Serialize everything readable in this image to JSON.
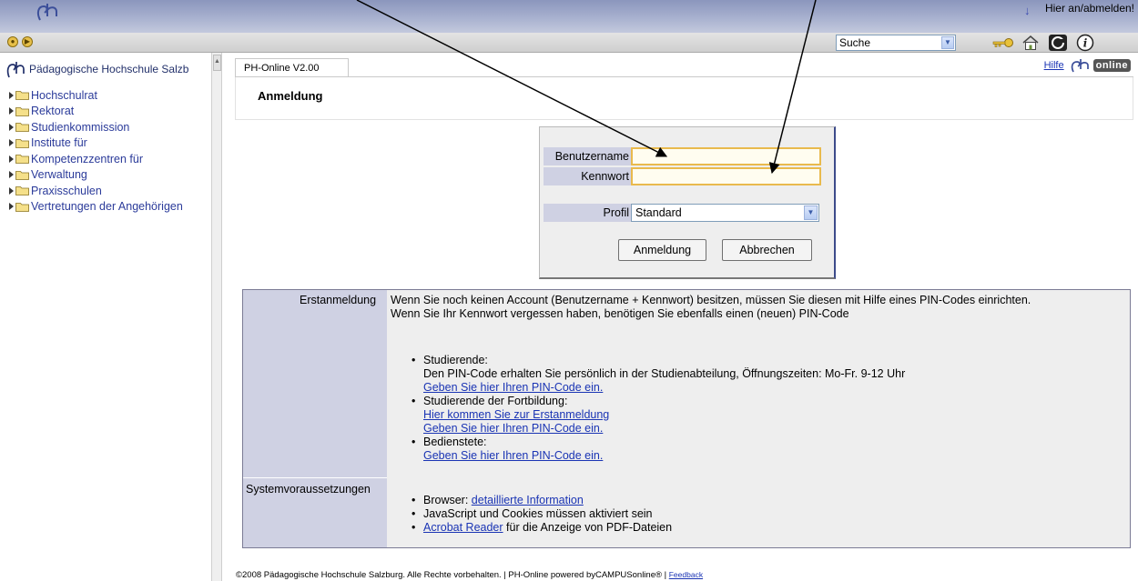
{
  "topbar": {
    "login_label": "Hier an/abmelden!",
    "login_arrow": "↓"
  },
  "toolbar": {
    "nav_icons": [
      "●",
      "▶"
    ],
    "search_value": "Suche",
    "icons": [
      "key-icon",
      "home-icon",
      "refresh-icon",
      "info-icon"
    ]
  },
  "sidebar": {
    "title": "Pädagogische Hochschule Salzb",
    "items": [
      "Hochschulrat",
      "Rektorat",
      "Studienkommission",
      "Institute für",
      "Kompetenzzentren für",
      "Verwaltung",
      "Praxisschulen",
      "Vertretungen der Angehörigen"
    ]
  },
  "main": {
    "tab_label": "PH-Online V2.00",
    "help_label": "Hilfe",
    "online_label": "online",
    "heading": "Anmeldung"
  },
  "login": {
    "username_label": "Benutzername",
    "username_value": "",
    "password_label": "Kennwort",
    "password_value": "",
    "profile_label": "Profil",
    "profile_value": "Standard",
    "login_button": "Anmeldung",
    "cancel_button": "Abbrechen"
  },
  "info": {
    "section1_label": "Erstanmeldung",
    "line1": "Wenn Sie noch keinen Account (Benutzername + Kennwort) besitzen, müssen Sie diesen mit Hilfe eines PIN-Codes einrichten.",
    "line2": "Wenn Sie Ihr Kennwort vergessen haben, benötigen Sie ebenfalls einen (neuen) PIN-Code",
    "students_title": "Studierende:",
    "students_text": "Den PIN-Code erhalten Sie persönlich in der Studienabteilung, Öffnungszeiten: Mo-Fr. 9-12 Uhr",
    "students_link": "Geben Sie hier Ihren PIN-Code ein.",
    "fortbildung_title": "Studierende der Fortbildung:",
    "fortbildung_link1": "Hier kommen Sie zur Erstanmeldung",
    "fortbildung_link2": "Geben Sie hier Ihren PIN-Code ein.",
    "staff_title": "Bedienstete:",
    "staff_link": "Geben Sie hier Ihren PIN-Code ein.",
    "section2_label": "Systemvoraussetzungen",
    "req1_text": "Browser: ",
    "req1_link": "detaillierte Information",
    "req2_text": "JavaScript und Cookies müssen aktiviert sein",
    "req3_link": "Acrobat Reader",
    "req3_text": " für die Anzeige von PDF-Dateien"
  },
  "footer": {
    "text": "©2008 Pädagogische Hochschule Salzburg. Alle Rechte vorbehalten. | PH-Online powered byCAMPUSonline® | ",
    "feedback": "Feedback"
  }
}
